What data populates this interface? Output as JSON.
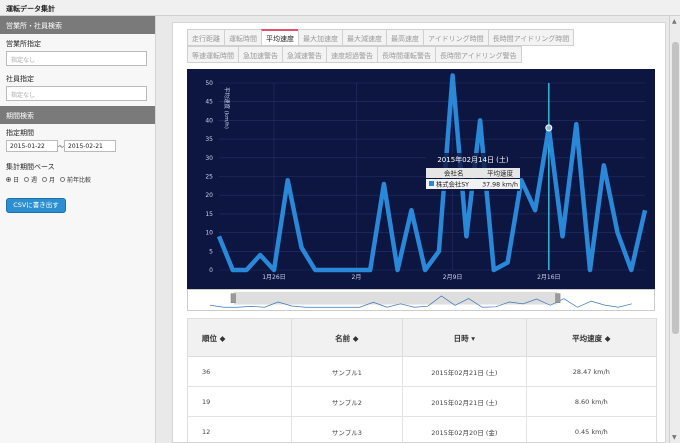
{
  "header": {
    "title": "運転データ集計"
  },
  "sidebar": {
    "section_office": "営業所・社員検索",
    "office_label": "営業所指定",
    "office_placeholder": "指定なし",
    "employee_label": "社員指定",
    "employee_placeholder": "指定なし",
    "section_period": "期間検索",
    "period_label": "指定期間",
    "date_from": "2015-01-22",
    "date_to": "2015-02-21",
    "date_sep": "〜",
    "base_label": "集計期間ベース",
    "radios": [
      {
        "label": "日",
        "checked": true
      },
      {
        "label": "週",
        "checked": false
      },
      {
        "label": "月",
        "checked": false
      },
      {
        "label": "前年比較",
        "checked": false
      }
    ],
    "csv_button": "CSVに書き出す"
  },
  "tabs_row1": [
    "走行距離",
    "運転時間",
    "平均速度",
    "最大加速度",
    "最大減速度",
    "最高速度",
    "アイドリング時間",
    "長時間アイドリング時間"
  ],
  "tabs_row2": [
    "等速運転時間",
    "急加速警告",
    "急減速警告",
    "速度超過警告",
    "長時間運転警告",
    "長時間アイドリング警告"
  ],
  "active_tab": "平均速度",
  "chart_data": {
    "type": "line",
    "ylabel": "平均速度 (km/h)",
    "ylim": [
      0,
      50
    ],
    "yticks": [
      0,
      5,
      10,
      15,
      20,
      25,
      30,
      35,
      40,
      45,
      50
    ],
    "xtick_labels": [
      "1月26日",
      "2月",
      "2月9日",
      "2月16日"
    ],
    "x": [
      "01-22",
      "01-23",
      "01-24",
      "01-25",
      "01-26",
      "01-27",
      "01-28",
      "01-29",
      "01-30",
      "01-31",
      "02-01",
      "02-02",
      "02-03",
      "02-04",
      "02-05",
      "02-06",
      "02-07",
      "02-08",
      "02-09",
      "02-10",
      "02-11",
      "02-12",
      "02-13",
      "02-14",
      "02-15",
      "02-16",
      "02-17",
      "02-18",
      "02-19",
      "02-20",
      "02-21"
    ],
    "series": [
      {
        "values": [
          9,
          0,
          0,
          4,
          0,
          24,
          6,
          0,
          0,
          0,
          0,
          0,
          23,
          0,
          16,
          0,
          5,
          52,
          9,
          40,
          0,
          2,
          24,
          16,
          38,
          9,
          39,
          0,
          28,
          10,
          0,
          16
        ],
        "color": "#2a88d8"
      }
    ],
    "tooltip": {
      "title": "2015年02月14日 (土)",
      "col1": "会社名",
      "col2": "平均速度",
      "company": "株式会社SY",
      "value": "37.98 km/h"
    },
    "highlight_index": 24
  },
  "table": {
    "headers": [
      "順位 ◆",
      "名前 ◆",
      "日時 ▾",
      "平均速度 ◆"
    ],
    "rows": [
      [
        "36",
        "サンプル1",
        "2015年02月21日 (土)",
        "28.47 km/h"
      ],
      [
        "19",
        "サンプル2",
        "2015年02月21日 (土)",
        "8.60 km/h"
      ],
      [
        "12",
        "サンプル3",
        "2015年02月20日 (金)",
        "0.45 km/h"
      ]
    ]
  }
}
